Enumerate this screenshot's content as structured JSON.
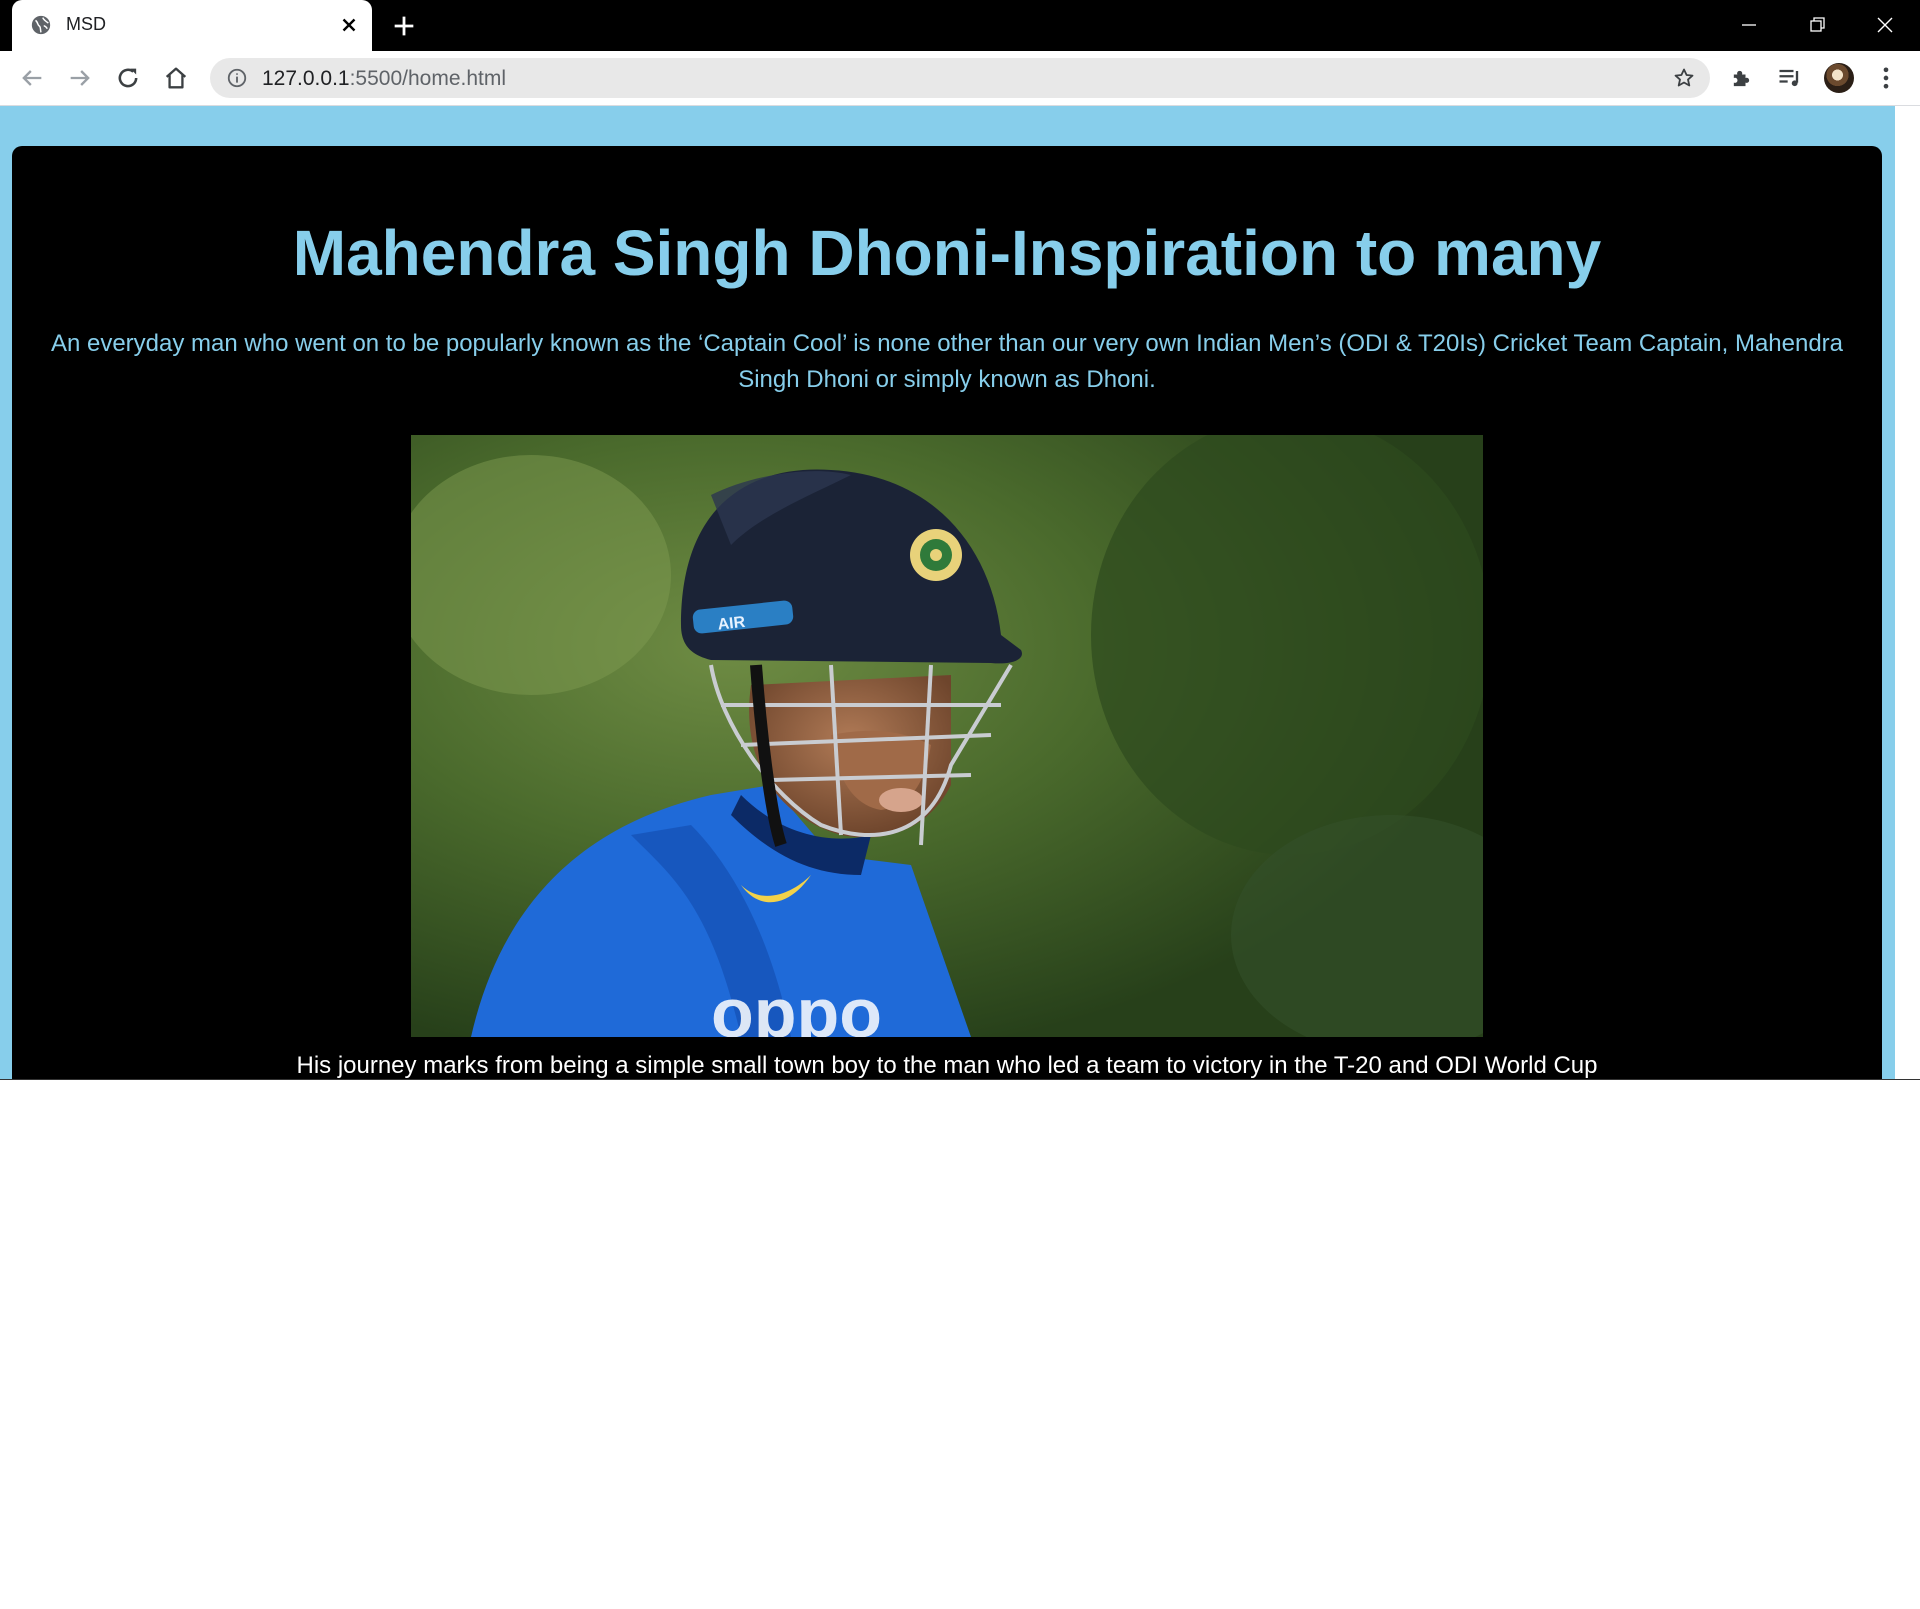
{
  "browser": {
    "tab_title": "MSD",
    "url_host": "127.0.0.1",
    "url_rest": ":5500/home.html"
  },
  "page": {
    "heading": "Mahendra Singh Dhoni-Inspiration to many",
    "intro": "An everyday man who went on to be popularly known as the ‘Captain Cool’ is none other than our very own Indian Men’s (ODI & T20Is) Cricket Team Captain, Mahendra Singh Dhoni or simply known as Dhoni.",
    "photo_helmet_text": "AIR",
    "journey": "His journey marks from being a simple small town boy to the man who led a team to victory in the T-20 and ODI World Cup"
  },
  "colors": {
    "background": "#87ceeb",
    "card": "#000000",
    "heading": "#87ceeb",
    "body_text": "#ffffff"
  },
  "icons": [
    "globe-icon",
    "close-icon",
    "plus-icon",
    "minimize-icon",
    "restore-icon",
    "window-close-icon",
    "back-arrow-icon",
    "forward-arrow-icon",
    "reload-icon",
    "home-icon",
    "info-icon",
    "star-icon",
    "extensions-icon",
    "media-icon",
    "kebab-menu-icon"
  ]
}
